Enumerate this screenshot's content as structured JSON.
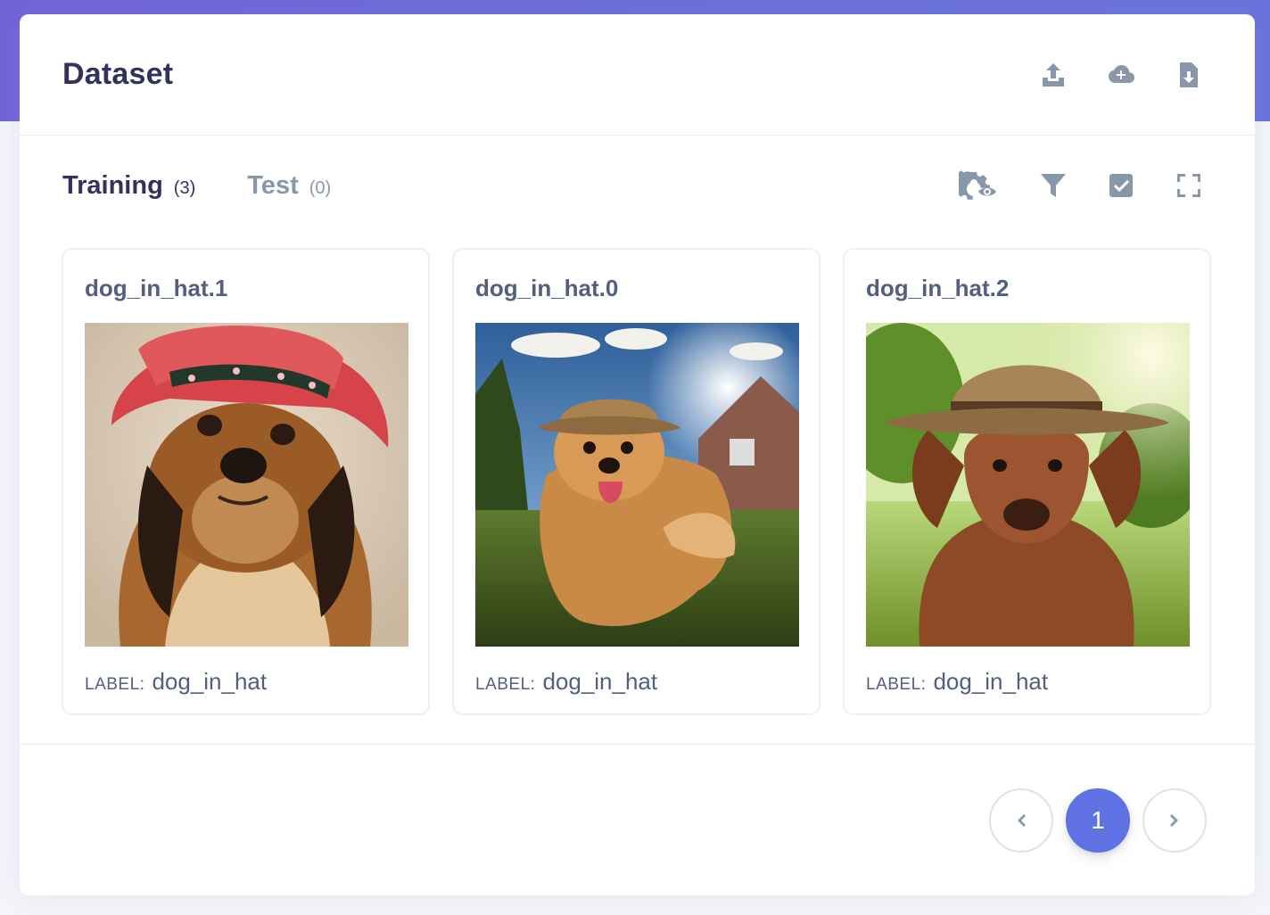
{
  "header": {
    "title": "Dataset",
    "actions": [
      {
        "icon": "upload-icon"
      },
      {
        "icon": "cloud-add-icon"
      },
      {
        "icon": "file-download-icon"
      }
    ]
  },
  "tabs": [
    {
      "label": "Training",
      "count": "(3)",
      "active": true
    },
    {
      "label": "Test",
      "count": "(0)",
      "active": false
    }
  ],
  "tools": [
    {
      "icon": "settings-view-icon"
    },
    {
      "icon": "filter-icon"
    },
    {
      "icon": "checkbox-icon"
    },
    {
      "icon": "fullscreen-icon"
    }
  ],
  "items": [
    {
      "title": "dog_in_hat.1",
      "label_key": "LABEL:",
      "label_value": "dog_in_hat",
      "image": "dog with red straw hat"
    },
    {
      "title": "dog_in_hat.0",
      "label_key": "LABEL:",
      "label_value": "dog_in_hat",
      "image": "fluffy dog in brown hat in sunny yard"
    },
    {
      "title": "dog_in_hat.2",
      "label_key": "LABEL:",
      "label_value": "dog_in_hat",
      "image": "brown dog with bowler hat in park"
    }
  ],
  "pagination": {
    "current": "1"
  },
  "colors": {
    "accent": "#5e72e4",
    "band": "#6b6fdc",
    "muted": "#8898aa",
    "heading": "#32325d"
  }
}
